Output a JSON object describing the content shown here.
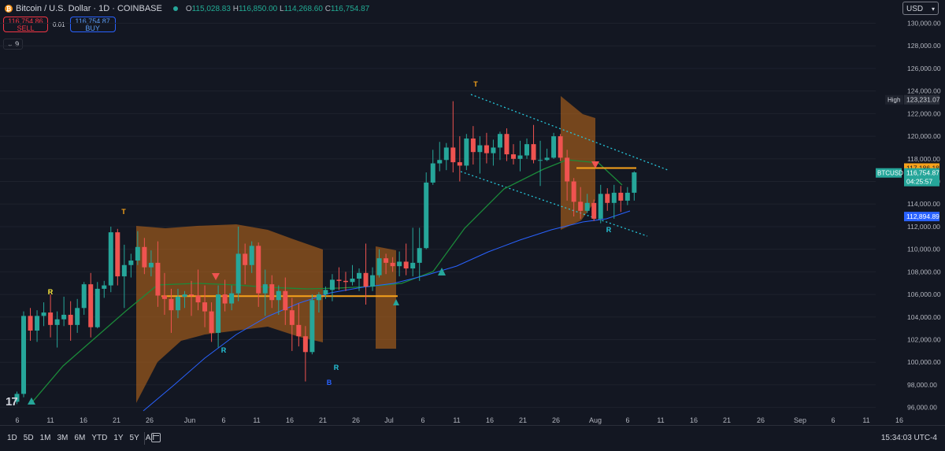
{
  "header": {
    "coin_symbol": "₿",
    "symbol_title": "Bitcoin / U.S. Dollar · 1D · COINBASE",
    "ohlc": {
      "o_label": "O",
      "o": "115,028.83",
      "h_label": "H",
      "h": "116,850.00",
      "l_label": "L",
      "l": "114,268.60",
      "c_label": "C",
      "c": "116,754.87"
    },
    "sell_price": "116,754.86",
    "sell_label": "SELL",
    "spread": "0.01",
    "buy_price": "116,754.87",
    "buy_label": "BUY",
    "indicator_toggle": "9",
    "currency": "USD"
  },
  "chart_data": {
    "type": "candlestick",
    "symbol": "BTCUSD",
    "ylim": [
      95000,
      131500
    ],
    "y_ticks": [
      "130,000.00",
      "128,000.00",
      "126,000.00",
      "124,000.00",
      "122,000.00",
      "120,000.00",
      "118,000.00",
      "116,000.00",
      "114,000.00",
      "112,000.00",
      "110,000.00",
      "108,000.00",
      "106,000.00",
      "104,000.00",
      "102,000.00",
      "100,000.00",
      "98,000.00",
      "96,000.00"
    ],
    "x_ticks": [
      "6",
      "11",
      "16",
      "21",
      "26",
      "Jun",
      "6",
      "11",
      "16",
      "21",
      "26",
      "Jul",
      "6",
      "11",
      "16",
      "21",
      "26",
      "Aug",
      "6",
      "11",
      "16",
      "21",
      "26",
      "Sep",
      "6",
      "11",
      "16"
    ],
    "candles": [
      [
        96500,
        97400,
        96300,
        97200
      ],
      [
        97200,
        104500,
        96900,
        104100
      ],
      [
        104100,
        104800,
        101900,
        102800
      ],
      [
        102800,
        104600,
        101800,
        104100
      ],
      [
        104100,
        105300,
        103200,
        104400
      ],
      [
        104400,
        106000,
        102200,
        103300
      ],
      [
        103300,
        104500,
        101300,
        103800
      ],
      [
        103800,
        105800,
        103200,
        104200
      ],
      [
        104200,
        105400,
        101900,
        103300
      ],
      [
        103300,
        105600,
        102600,
        104800
      ],
      [
        104800,
        107100,
        104200,
        106900
      ],
      [
        106900,
        107900,
        102200,
        103100
      ],
      [
        103100,
        107100,
        103000,
        106500
      ],
      [
        106500,
        107200,
        105700,
        106800
      ],
      [
        106800,
        112000,
        106200,
        111500
      ],
      [
        111500,
        111800,
        106800,
        107600
      ],
      [
        107600,
        110400,
        104800,
        108600
      ],
      [
        108600,
        109600,
        107500,
        109000
      ],
      [
        109000,
        111600,
        108600,
        110200
      ],
      [
        110200,
        111000,
        107800,
        108400
      ],
      [
        108400,
        109900,
        107600,
        108800
      ],
      [
        108800,
        110700,
        104900,
        105900
      ],
      [
        105900,
        107900,
        104200,
        105600
      ],
      [
        105600,
        106500,
        102600,
        104600
      ],
      [
        104600,
        106500,
        103900,
        105800
      ],
      [
        105800,
        106300,
        104800,
        106000
      ],
      [
        106000,
        107200,
        104100,
        105900
      ],
      [
        105900,
        108200,
        104600,
        105300
      ],
      [
        105300,
        106800,
        103100,
        104500
      ],
      [
        104500,
        105300,
        101800,
        102600
      ],
      [
        102600,
        106800,
        101300,
        106000
      ],
      [
        106000,
        107300,
        104500,
        105200
      ],
      [
        105200,
        106800,
        104600,
        106100
      ],
      [
        106100,
        112000,
        105400,
        109600
      ],
      [
        109600,
        110500,
        106900,
        108600
      ],
      [
        108600,
        110700,
        107900,
        110300
      ],
      [
        110300,
        110600,
        104900,
        106100
      ],
      [
        106100,
        108200,
        104100,
        106900
      ],
      [
        106900,
        107700,
        104800,
        105500
      ],
      [
        105500,
        106800,
        104200,
        106300
      ],
      [
        106300,
        107500,
        103300,
        104600
      ],
      [
        104600,
        105700,
        101000,
        103300
      ],
      [
        103300,
        105200,
        101400,
        102300
      ],
      [
        102300,
        103200,
        98300,
        100900
      ],
      [
        100900,
        106000,
        100700,
        105500
      ],
      [
        105500,
        106200,
        104400,
        106000
      ],
      [
        106000,
        106700,
        105600,
        106400
      ],
      [
        106400,
        107800,
        105400,
        107300
      ],
      [
        107300,
        108400,
        106400,
        107200
      ],
      [
        107200,
        108000,
        106300,
        107100
      ],
      [
        107100,
        108600,
        106800,
        107400
      ],
      [
        107400,
        108300,
        106300,
        107900
      ],
      [
        107900,
        110500,
        105100,
        106700
      ],
      [
        106700,
        108400,
        106300,
        107700
      ],
      [
        107700,
        110000,
        107500,
        109200
      ],
      [
        109200,
        109600,
        107800,
        108800
      ],
      [
        108800,
        109300,
        108000,
        108500
      ],
      [
        108500,
        109800,
        107600,
        108900
      ],
      [
        108900,
        110500,
        107700,
        108300
      ],
      [
        108300,
        111900,
        107600,
        108800
      ],
      [
        108800,
        111900,
        107200,
        110100
      ],
      [
        110100,
        116800,
        110000,
        115900
      ],
      [
        115900,
        118800,
        115700,
        117600
      ],
      [
        117600,
        119500,
        116900,
        117900
      ],
      [
        117900,
        119400,
        117000,
        119000
      ],
      [
        119000,
        123100,
        116800,
        117700
      ],
      [
        117700,
        120000,
        116000,
        117400
      ],
      [
        117400,
        120200,
        117000,
        119800
      ],
      [
        119800,
        120900,
        117500,
        118600
      ],
      [
        118600,
        120000,
        116700,
        119200
      ],
      [
        119200,
        120300,
        117600,
        118500
      ],
      [
        118500,
        119700,
        117400,
        119000
      ],
      [
        119000,
        120400,
        117900,
        120200
      ],
      [
        120200,
        120700,
        117800,
        118400
      ],
      [
        118400,
        119300,
        117500,
        118000
      ],
      [
        118000,
        119600,
        116900,
        118300
      ],
      [
        118300,
        119800,
        118000,
        119300
      ],
      [
        119300,
        121000,
        117600,
        117900
      ],
      [
        117900,
        119600,
        115600,
        117900
      ],
      [
        117900,
        118900,
        117800,
        118100
      ],
      [
        118100,
        120300,
        118000,
        120000
      ],
      [
        120000,
        120200,
        117800,
        118100
      ],
      [
        118100,
        118800,
        114300,
        116000
      ],
      [
        116000,
        116300,
        112900,
        114200
      ],
      [
        114200,
        115500,
        112700,
        113400
      ],
      [
        113400,
        114900,
        113200,
        114100
      ],
      [
        114100,
        114400,
        112500,
        112700
      ],
      [
        112700,
        115700,
        112300,
        114900
      ],
      [
        114900,
        115400,
        113400,
        114100
      ],
      [
        114100,
        115700,
        112700,
        115000
      ],
      [
        115000,
        115600,
        113300,
        114300
      ],
      [
        114300,
        115500,
        113900,
        115000
      ],
      [
        115000,
        116900,
        114300,
        116800
      ]
    ],
    "annotations": {
      "labels": [
        "T",
        "R",
        "R",
        "B",
        "R",
        "R",
        "T"
      ],
      "high_label": "High",
      "high_value": "123,231.07",
      "sym_badge": "BTCUSD",
      "last_price": "116,754.87",
      "countdown": "04:25:57",
      "orange_level": "117,186.18",
      "blue_level": "112,894.89"
    },
    "levels": {
      "high": 123231.07,
      "last": 116754.87,
      "orange": 117186.18,
      "blue": 112894.89
    }
  },
  "footer": {
    "ranges": [
      "1D",
      "5D",
      "1M",
      "3M",
      "6M",
      "YTD",
      "1Y",
      "5Y",
      "All"
    ],
    "clock": "15:34:03 UTC-4"
  },
  "colors": {
    "up": "#26a69a",
    "down": "#ef5350",
    "accent_orange": "#f7a21b",
    "ema_green": "#1b8a3a",
    "ma_blue": "#2962ff",
    "band": "#b8661a",
    "yellow": "#ffeb3b"
  }
}
